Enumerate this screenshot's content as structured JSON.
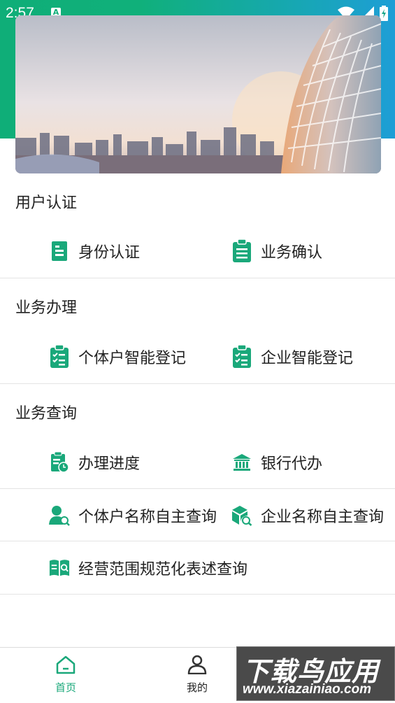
{
  "status_bar": {
    "time": "2:57",
    "a_badge": "A"
  },
  "sections": [
    {
      "title": "用户认证",
      "items": [
        {
          "label": "身份认证",
          "icon": "id-card-icon"
        },
        {
          "label": "业务确认",
          "icon": "clipboard-list-icon"
        }
      ]
    },
    {
      "title": "业务办理",
      "items": [
        {
          "label": "个体户智能登记",
          "icon": "checklist-icon"
        },
        {
          "label": "企业智能登记",
          "icon": "checklist-icon"
        }
      ]
    },
    {
      "title": "业务查询",
      "items": [
        {
          "label": "办理进度",
          "icon": "progress-clock-icon"
        },
        {
          "label": "银行代办",
          "icon": "bank-icon"
        },
        {
          "label": "个体户名称自主查询",
          "icon": "person-search-icon"
        },
        {
          "label": "企业名称自主查询",
          "icon": "box-search-icon"
        },
        {
          "label": "经营范围规范化表述查询",
          "icon": "book-search-icon"
        }
      ]
    }
  ],
  "bottom_nav": [
    {
      "label": "首页",
      "icon": "home-icon",
      "active": true
    },
    {
      "label": "我的",
      "icon": "user-icon",
      "active": false
    }
  ],
  "watermark": {
    "big": "下载鸟应用",
    "small": "www.xiazainiao.com"
  },
  "colors": {
    "accent": "#1aa87a",
    "divider": "#e4e4e4",
    "text": "#222222"
  }
}
